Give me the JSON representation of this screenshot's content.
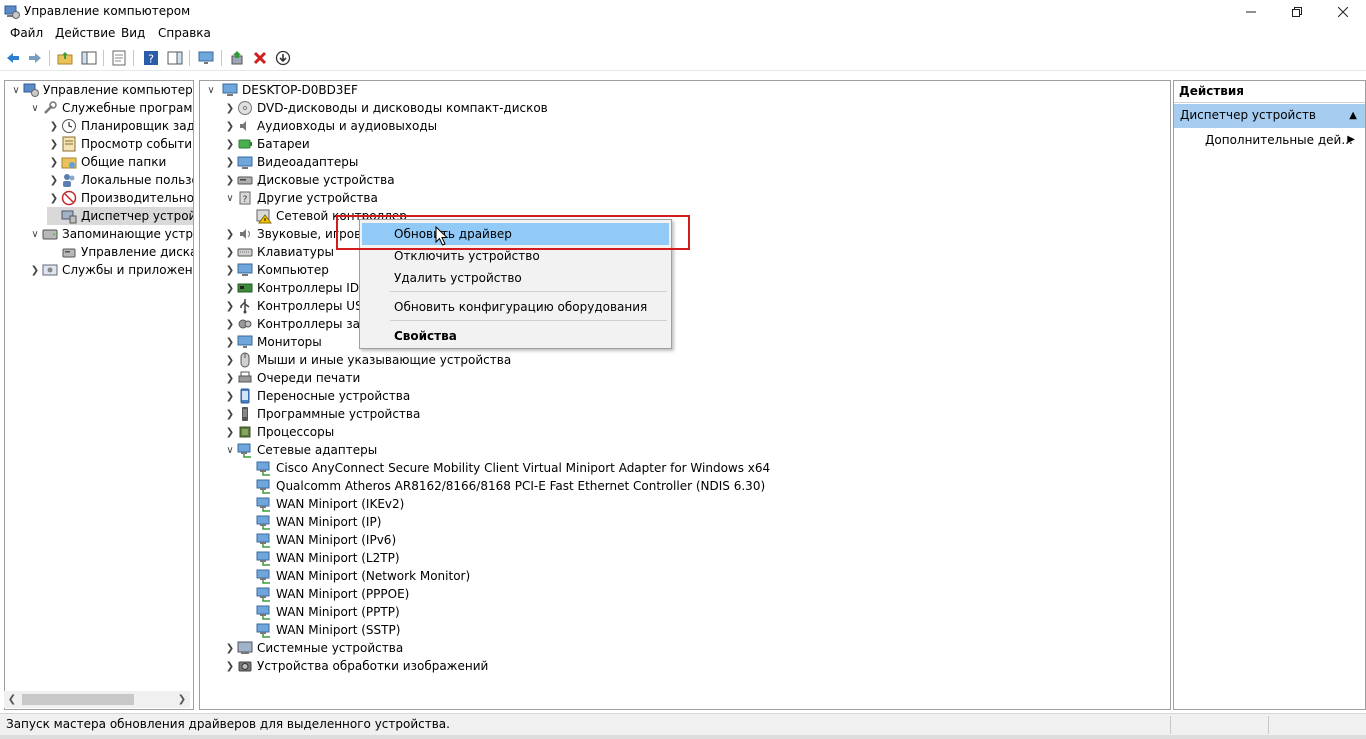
{
  "window": {
    "title": "Управление компьютером",
    "minimize_icon": "minimize-icon",
    "maximize_icon": "restore-icon",
    "close_icon": "close-icon"
  },
  "menu": [
    "Файл",
    "Действие",
    "Вид",
    "Справка"
  ],
  "toolbar": [
    "back-arrow-icon",
    "forward-arrow-icon",
    "up-folder-icon",
    "show-hide-tree-icon",
    "properties-icon",
    "help-icon",
    "view-toggle-icon",
    "monitor-icon",
    "update-driver-icon",
    "remove-icon",
    "download-icon"
  ],
  "left_tree": {
    "items": [
      {
        "label": "Управление компьютером (л",
        "level": 0,
        "expanded": true,
        "icon": "computer-management-icon"
      },
      {
        "label": "Служебные программы",
        "level": 1,
        "expanded": true,
        "icon": "tools-icon"
      },
      {
        "label": "Планировщик заданий",
        "level": 2,
        "expanded": false,
        "icon": "clock-icon"
      },
      {
        "label": "Просмотр событий",
        "level": 2,
        "expanded": false,
        "icon": "event-viewer-icon"
      },
      {
        "label": "Общие папки",
        "level": 2,
        "expanded": false,
        "icon": "shared-folder-icon"
      },
      {
        "label": "Локальные пользовате",
        "level": 2,
        "expanded": false,
        "icon": "users-icon"
      },
      {
        "label": "Производительность",
        "level": 2,
        "expanded": false,
        "icon": "performance-icon"
      },
      {
        "label": "Диспетчер устройств",
        "level": 2,
        "expanded": null,
        "icon": "device-manager-icon",
        "selected": true
      },
      {
        "label": "Запоминающие устройст",
        "level": 1,
        "expanded": true,
        "icon": "storage-icon"
      },
      {
        "label": "Управление дисками",
        "level": 2,
        "expanded": null,
        "icon": "disk-management-icon"
      },
      {
        "label": "Службы и приложения",
        "level": 1,
        "expanded": false,
        "icon": "services-icon"
      }
    ]
  },
  "device_tree": {
    "root": "DESKTOP-D0BD3EF",
    "items": [
      {
        "label": "DVD-дисководы и дисководы компакт-дисков",
        "level": 1,
        "expanded": false,
        "icon": "dvd-drive-icon"
      },
      {
        "label": "Аудиовходы и аудиовыходы",
        "level": 1,
        "expanded": false,
        "icon": "speaker-icon"
      },
      {
        "label": "Батареи",
        "level": 1,
        "expanded": false,
        "icon": "battery-icon"
      },
      {
        "label": "Видеоадаптеры",
        "level": 1,
        "expanded": false,
        "icon": "display-adapter-icon"
      },
      {
        "label": "Дисковые устройства",
        "level": 1,
        "expanded": false,
        "icon": "disk-drive-icon"
      },
      {
        "label": "Другие устройства",
        "level": 1,
        "expanded": true,
        "icon": "unknown-device-icon"
      },
      {
        "label": "Сетевой контроллер",
        "level": 2,
        "expanded": null,
        "icon": "warning-device-icon"
      },
      {
        "label": "Звуковые, игровые",
        "level": 1,
        "expanded": false,
        "icon": "sound-icon"
      },
      {
        "label": "Клавиатуры",
        "level": 1,
        "expanded": false,
        "icon": "keyboard-icon"
      },
      {
        "label": "Компьютер",
        "level": 1,
        "expanded": false,
        "icon": "computer-icon"
      },
      {
        "label": "Контроллеры IDE",
        "level": 1,
        "expanded": false,
        "icon": "ide-controller-icon"
      },
      {
        "label": "Контроллеры USB",
        "level": 1,
        "expanded": false,
        "icon": "usb-icon"
      },
      {
        "label": "Контроллеры зап",
        "level": 1,
        "expanded": false,
        "icon": "storage-controller-icon"
      },
      {
        "label": "Мониторы",
        "level": 1,
        "expanded": false,
        "icon": "monitor-icon"
      },
      {
        "label": "Мыши и иные указывающие устройства",
        "level": 1,
        "expanded": false,
        "icon": "mouse-icon"
      },
      {
        "label": "Очереди печати",
        "level": 1,
        "expanded": false,
        "icon": "printer-icon"
      },
      {
        "label": "Переносные устройства",
        "level": 1,
        "expanded": false,
        "icon": "portable-device-icon"
      },
      {
        "label": "Программные устройства",
        "level": 1,
        "expanded": false,
        "icon": "software-device-icon"
      },
      {
        "label": "Процессоры",
        "level": 1,
        "expanded": false,
        "icon": "processor-icon"
      },
      {
        "label": "Сетевые адаптеры",
        "level": 1,
        "expanded": true,
        "icon": "network-adapter-icon"
      },
      {
        "label": "Cisco AnyConnect Secure Mobility Client Virtual Miniport Adapter for Windows x64",
        "level": 2,
        "expanded": null,
        "icon": "network-adapter-icon"
      },
      {
        "label": "Qualcomm Atheros AR8162/8166/8168 PCI-E Fast Ethernet Controller (NDIS 6.30)",
        "level": 2,
        "expanded": null,
        "icon": "network-adapter-icon"
      },
      {
        "label": "WAN Miniport (IKEv2)",
        "level": 2,
        "expanded": null,
        "icon": "network-adapter-icon"
      },
      {
        "label": "WAN Miniport (IP)",
        "level": 2,
        "expanded": null,
        "icon": "network-adapter-icon"
      },
      {
        "label": "WAN Miniport (IPv6)",
        "level": 2,
        "expanded": null,
        "icon": "network-adapter-icon"
      },
      {
        "label": "WAN Miniport (L2TP)",
        "level": 2,
        "expanded": null,
        "icon": "network-adapter-icon"
      },
      {
        "label": "WAN Miniport (Network Monitor)",
        "level": 2,
        "expanded": null,
        "icon": "network-adapter-icon"
      },
      {
        "label": "WAN Miniport (PPPOE)",
        "level": 2,
        "expanded": null,
        "icon": "network-adapter-icon"
      },
      {
        "label": "WAN Miniport (PPTP)",
        "level": 2,
        "expanded": null,
        "icon": "network-adapter-icon"
      },
      {
        "label": "WAN Miniport (SSTP)",
        "level": 2,
        "expanded": null,
        "icon": "network-adapter-icon"
      },
      {
        "label": "Системные устройства",
        "level": 1,
        "expanded": false,
        "icon": "system-device-icon"
      },
      {
        "label": "Устройства обработки изображений",
        "level": 1,
        "expanded": false,
        "icon": "imaging-device-icon"
      }
    ]
  },
  "context_menu": {
    "update_driver": "Обновить драйвер",
    "disable_device": "Отключить устройство",
    "uninstall_device": "Удалить устройство",
    "scan_hardware": "Обновить конфигурацию оборудования",
    "properties": "Свойства"
  },
  "actions_pane": {
    "title": "Действия",
    "section": "Диспетчер устройств",
    "more": "Дополнительные дей..."
  },
  "status": {
    "text": "Запуск мастера обновления драйверов для выделенного устройства."
  },
  "colors": {
    "highlight": "#91c9f7",
    "section": "#a6cdf0",
    "annotation_red": "#d01c1c"
  }
}
